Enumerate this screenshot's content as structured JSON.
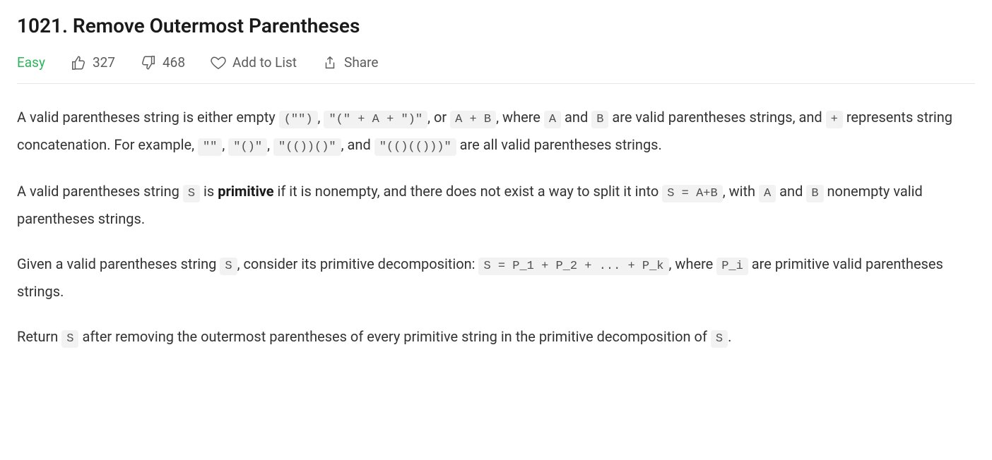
{
  "title": "1021. Remove Outermost Parentheses",
  "difficulty": "Easy",
  "toolbar": {
    "likes": "327",
    "dislikes": "468",
    "add_to_list": "Add to List",
    "share": "Share"
  },
  "paragraphs": {
    "p1": {
      "t0": "A valid parentheses string is either empty ",
      "c0": "(\"\")",
      "t1": ", ",
      "c1": "\"(\" + A + \")\"",
      "t2": ", or ",
      "c2": "A + B",
      "t3": ", where ",
      "c3": "A",
      "t4": " and ",
      "c4": "B",
      "t5": " are valid parentheses strings, and ",
      "c5": "+",
      "t6": " represents string concatenation.  For example, ",
      "c6": "\"\"",
      "t7": ", ",
      "c7": "\"()\"",
      "t8": ", ",
      "c8": "\"(())()\"",
      "t9": ", and ",
      "c9": "\"(()(()))\"",
      "t10": " are all valid parentheses strings."
    },
    "p2": {
      "t0": "A valid parentheses string ",
      "c0": "S",
      "t1": " is ",
      "s0": "primitive",
      "t2": " if it is nonempty, and there does not exist a way to split it into ",
      "c1": "S = A+B",
      "t3": ", with ",
      "c2": "A",
      "t4": " and ",
      "c3": "B",
      "t5": " nonempty valid parentheses strings."
    },
    "p3": {
      "t0": "Given a valid parentheses string ",
      "c0": "S",
      "t1": ", consider its primitive decomposition: ",
      "c1": "S = P_1 + P_2 + ... + P_k",
      "t2": ", where ",
      "c2": "P_i",
      "t3": " are primitive valid parentheses strings."
    },
    "p4": {
      "t0": "Return ",
      "c0": "S",
      "t1": " after removing the outermost parentheses of every primitive string in the primitive decomposition of ",
      "c1": "S",
      "t2": "."
    }
  }
}
